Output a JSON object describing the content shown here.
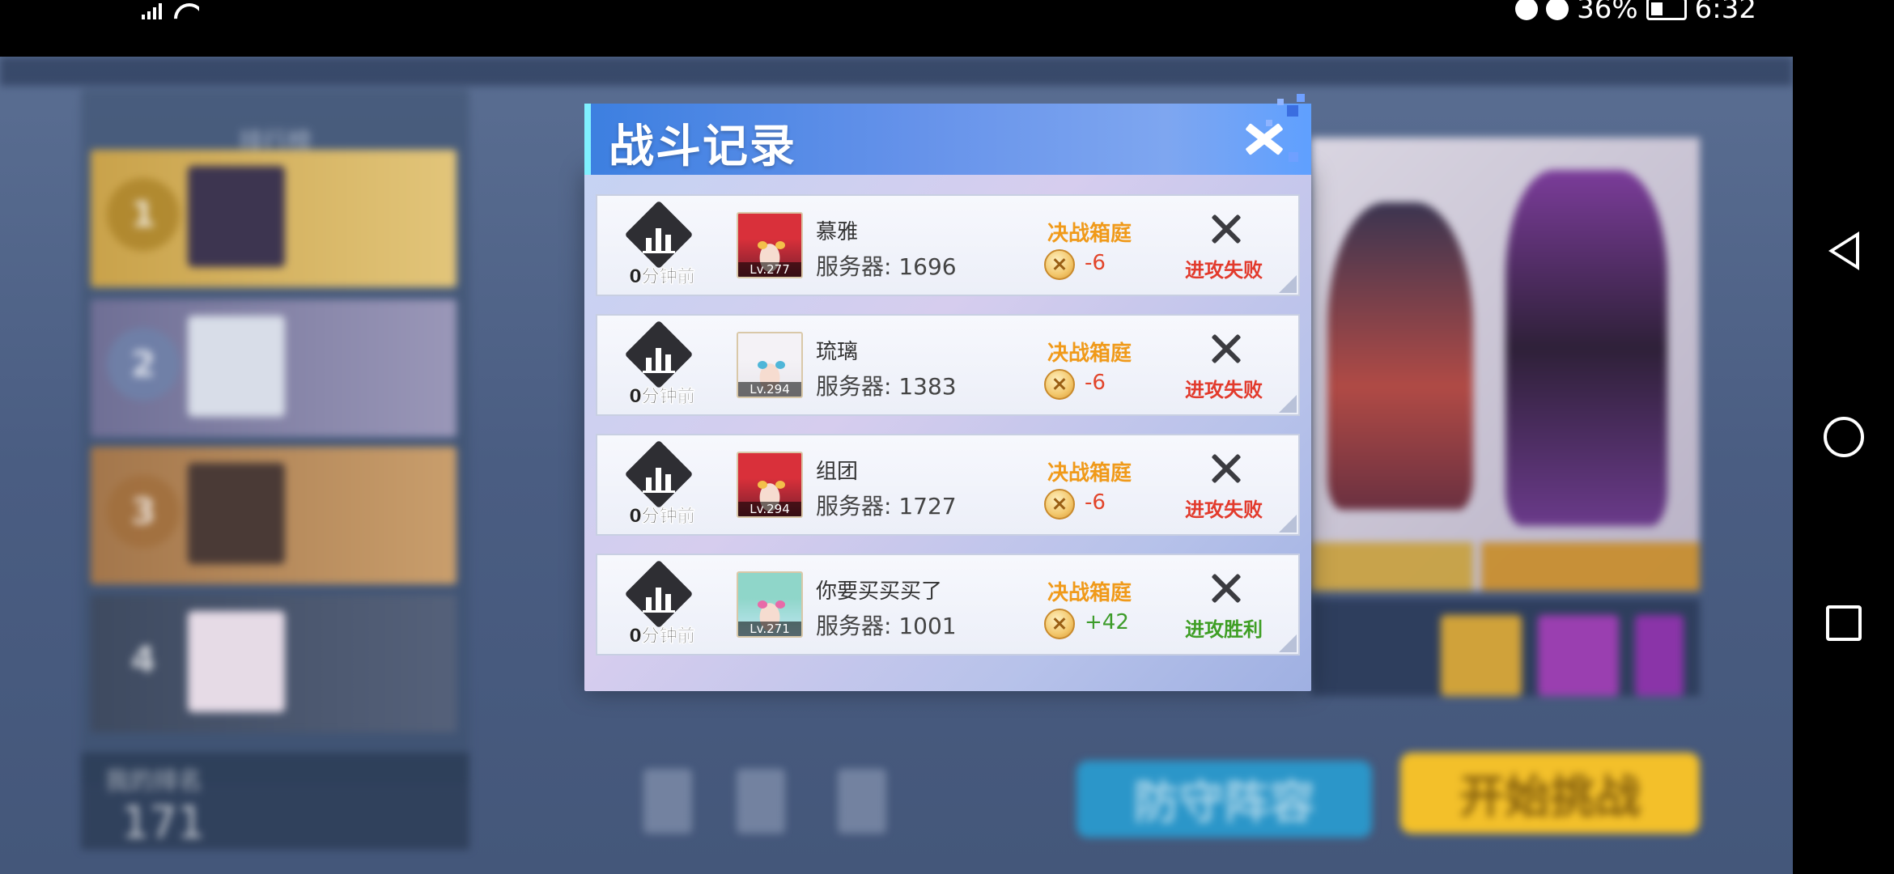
{
  "status_bar": {
    "battery_percent": "36%",
    "time": "6:32",
    "icons": [
      "signal-icon",
      "wifi-icon",
      "alarm-icon",
      "mute-icon",
      "battery-icon"
    ]
  },
  "nav_bar": {
    "icons": [
      "back-icon",
      "home-icon",
      "recents-icon"
    ]
  },
  "background": {
    "left_panel_title": "排行榜",
    "my_rank_label": "我的排名",
    "my_rank_value": "171",
    "defense_button_label": "防守阵容",
    "start_button_label": "开始挑战"
  },
  "dialog": {
    "title": "战斗记录",
    "close_icon": "close-icon",
    "records": [
      {
        "time": "0分钟前",
        "name": "慕雅",
        "server": "服务器: 1696",
        "level": "Lv.277",
        "mode": "决战箱庭",
        "delta": "-6",
        "result": "进攻失败",
        "outcome": "lose",
        "avatar_colors": {
          "bg": "#7a1f2e",
          "hair": "#d9303a",
          "eye": "#f3c04a"
        }
      },
      {
        "time": "0分钟前",
        "name": "琉璃",
        "server": "服务器: 1383",
        "level": "Lv.294",
        "mode": "决战箱庭",
        "delta": "-6",
        "result": "进攻失败",
        "outcome": "lose",
        "avatar_colors": {
          "bg": "#e9e6ec",
          "hair": "#f4f2f6",
          "eye": "#4fb6d8"
        }
      },
      {
        "time": "0分钟前",
        "name": "组团",
        "server": "服务器: 1727",
        "level": "Lv.294",
        "mode": "决战箱庭",
        "delta": "-6",
        "result": "进攻失败",
        "outcome": "lose",
        "avatar_colors": {
          "bg": "#7a1f2e",
          "hair": "#d9303a",
          "eye": "#f3c04a"
        }
      },
      {
        "time": "0分钟前",
        "name": "你要买买买了",
        "server": "服务器: 1001",
        "level": "Lv.271",
        "mode": "决战箱庭",
        "delta": "+42",
        "result": "进攻胜利",
        "outcome": "win",
        "avatar_colors": {
          "bg": "#bfe6f2",
          "hair": "#8fd6c9",
          "eye": "#e86aa8"
        }
      }
    ]
  },
  "colors": {
    "mode_text": "#f09a1a",
    "lose": "#e23a2c",
    "win": "#3e9e24",
    "header": "#4f86e6"
  }
}
